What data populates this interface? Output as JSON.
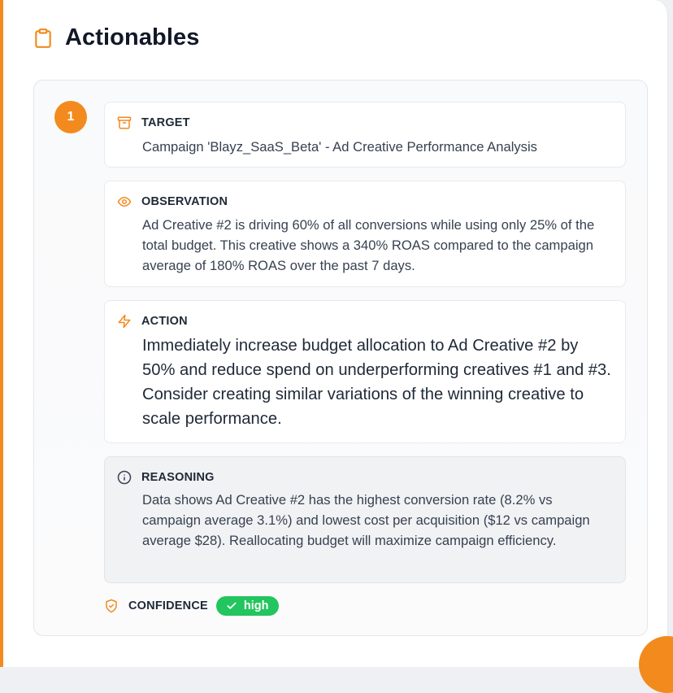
{
  "header": {
    "title": "Actionables",
    "icon": "clipboard-icon"
  },
  "item": {
    "number": "1",
    "target": {
      "label": "TARGET",
      "text": "Campaign 'Blayz_SaaS_Beta' - Ad Creative Performance Analysis",
      "icon": "archive-icon"
    },
    "observation": {
      "label": "OBSERVATION",
      "text": "Ad Creative #2 is driving 60% of all conversions while using only 25% of the total budget. This creative shows a 340% ROAS compared to the campaign average of 180% ROAS over the past 7 days.",
      "icon": "eye-icon"
    },
    "action": {
      "label": "ACTION",
      "text": "Immediately increase budget allocation to Ad Creative #2 by 50% and reduce spend on underperforming creatives #1 and #3. Consider creating similar variations of the winning creative to scale performance.",
      "icon": "lightning-icon"
    },
    "reasoning": {
      "label": "REASONING",
      "text": "Data shows Ad Creative #2 has the highest conversion rate (8.2% vs campaign average 3.1%) and lowest cost per acquisition ($12 vs campaign average $28). Reallocating budget will maximize campaign efficiency.",
      "icon": "info-icon"
    },
    "confidence": {
      "label": "CONFIDENCE",
      "value": "high",
      "icon": "shield-check-icon"
    }
  },
  "colors": {
    "accent": "#f28a1e",
    "success": "#22c55e"
  }
}
